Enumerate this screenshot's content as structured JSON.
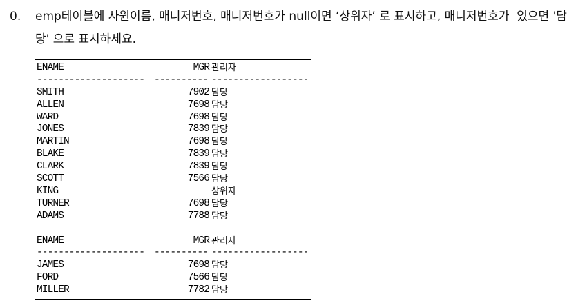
{
  "question": {
    "number": "0.",
    "text": "emp테이블에 사원이름, 매니저번호, 매니저번호가 null이면 ‘상위자’ 로 표시하고, 매니저번호가  있으면 '담당' 으로 표시하세요."
  },
  "result": {
    "columns": [
      "ENAME",
      "MGR",
      "관리자"
    ],
    "page1": [
      {
        "ename": "SMITH",
        "mgr": "7902",
        "mgrname": "담당"
      },
      {
        "ename": "ALLEN",
        "mgr": "7698",
        "mgrname": "담당"
      },
      {
        "ename": "WARD",
        "mgr": "7698",
        "mgrname": "담당"
      },
      {
        "ename": "JONES",
        "mgr": "7839",
        "mgrname": "담당"
      },
      {
        "ename": "MARTIN",
        "mgr": "7698",
        "mgrname": "담당"
      },
      {
        "ename": "BLAKE",
        "mgr": "7839",
        "mgrname": "담당"
      },
      {
        "ename": "CLARK",
        "mgr": "7839",
        "mgrname": "담당"
      },
      {
        "ename": "SCOTT",
        "mgr": "7566",
        "mgrname": "담당"
      },
      {
        "ename": "KING",
        "mgr": "",
        "mgrname": "상위자"
      },
      {
        "ename": "TURNER",
        "mgr": "7698",
        "mgrname": "담당"
      },
      {
        "ename": "ADAMS",
        "mgr": "7788",
        "mgrname": "담당"
      }
    ],
    "page2": [
      {
        "ename": "JAMES",
        "mgr": "7698",
        "mgrname": "담당"
      },
      {
        "ename": "FORD",
        "mgr": "7566",
        "mgrname": "담당"
      },
      {
        "ename": "MILLER",
        "mgr": "7782",
        "mgrname": "담당"
      }
    ]
  }
}
